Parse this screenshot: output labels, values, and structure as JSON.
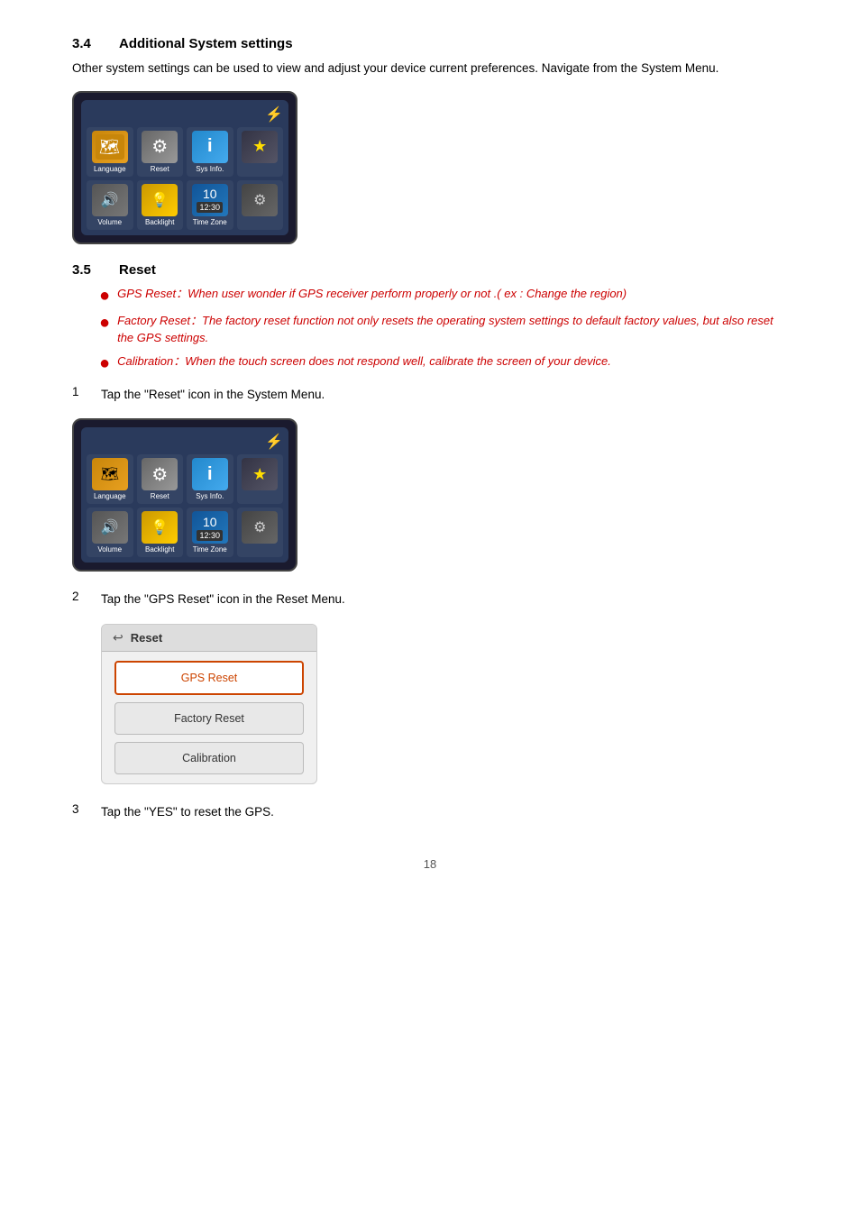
{
  "sections": {
    "s34": {
      "number": "3.4",
      "title": "Additional System settings",
      "body": "Other system settings can be used to view and adjust your device current preferences. Navigate from the System Menu."
    },
    "s35": {
      "number": "3.5",
      "title": "Reset",
      "bullets": [
        {
          "text": "GPS Reset：When user wonder if GPS receiver perform properly or not .( ex : Change the region)"
        },
        {
          "text": "Factory Reset：The factory reset function not only resets the operating system settings to default factory values, but also reset the GPS settings."
        },
        {
          "text": "Calibration：When the touch screen does not respond well, calibrate the screen of your device."
        }
      ],
      "steps": [
        {
          "number": "1",
          "text": "Tap the \"Reset\" icon in the System Menu."
        },
        {
          "number": "2",
          "text": "Tap the \"GPS Reset\" icon in the Reset Menu."
        },
        {
          "number": "3",
          "text": "Tap the \"YES\" to reset the GPS."
        }
      ]
    }
  },
  "device": {
    "icons": [
      {
        "label": "Language",
        "class": "icon-language",
        "symbol": "🗺"
      },
      {
        "label": "Reset",
        "class": "icon-reset",
        "symbol": "⚙"
      },
      {
        "label": "Sys Info.",
        "class": "icon-sysinfo",
        "symbol": "ℹ"
      },
      {
        "label": "",
        "class": "icon-star",
        "symbol": "★"
      },
      {
        "label": "Volume",
        "class": "icon-volume",
        "symbol": "🔊"
      },
      {
        "label": "Backlight",
        "class": "icon-backlight",
        "symbol": "💡"
      },
      {
        "label": "Time Zone",
        "class": "icon-timezone",
        "symbol": "🕐"
      },
      {
        "label": "",
        "class": "icon-settings",
        "symbol": "⚙"
      }
    ]
  },
  "reset_menu": {
    "header_back": "↩",
    "header_title": "Reset",
    "buttons": [
      {
        "label": "GPS Reset",
        "selected": true
      },
      {
        "label": "Factory Reset",
        "selected": false
      },
      {
        "label": "Calibration",
        "selected": false
      }
    ]
  },
  "page_number": "18"
}
